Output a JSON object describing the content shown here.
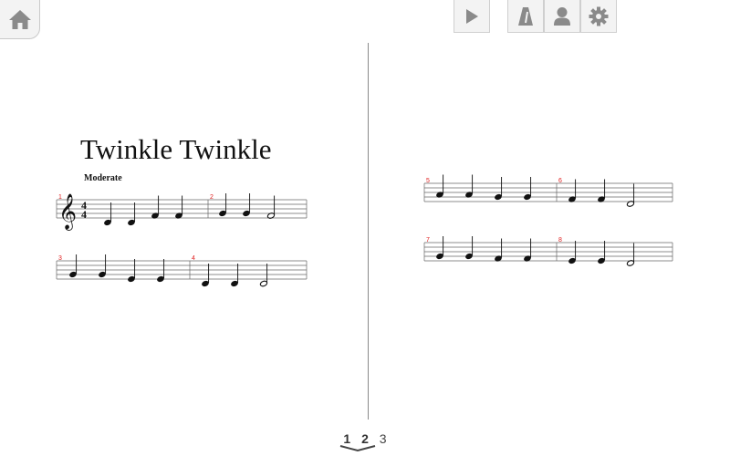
{
  "toolbar": {
    "home": "home-icon",
    "play": "play-icon",
    "metronome": "metronome-icon",
    "user": "person-icon",
    "settings": "gear-icon"
  },
  "score": {
    "title": "Twinkle Twinkle",
    "tempo": "Moderate",
    "time_signature": {
      "top": "4",
      "bottom": "4"
    },
    "clef": "treble",
    "measure_numbers": [
      "1",
      "2",
      "3",
      "4",
      "5",
      "6",
      "7",
      "8"
    ]
  },
  "pager": {
    "pages": [
      "1",
      "2",
      "3"
    ],
    "current": "1"
  },
  "colors": {
    "measure_number": "#e02020",
    "toolbar_bg": "#f3f3f3",
    "toolbar_icon": "#8a8a8a"
  }
}
